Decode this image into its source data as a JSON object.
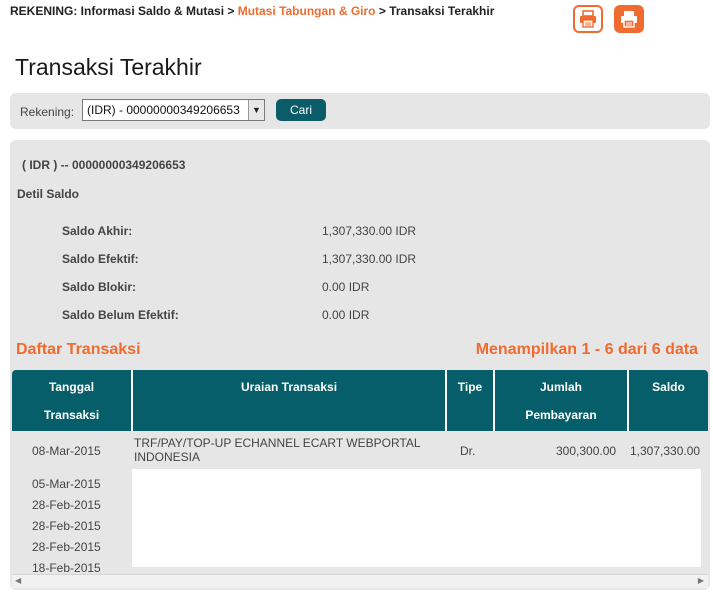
{
  "breadcrumb": {
    "section": "REKENING: Informasi Saldo & Mutasi",
    "sep1": ">",
    "link": "Mutasi Tabungan & Giro",
    "sep2": ">",
    "current": "Transaksi Terakhir"
  },
  "toolbar": {
    "print_icon": "printer-icon",
    "print_alt_icon": "printer-icon"
  },
  "page_title": "Transaksi Terakhir",
  "filter": {
    "label": "Rekening:",
    "selected": "(IDR) - 00000000349206653",
    "search_label": "Cari"
  },
  "account": {
    "header": "( IDR ) -- 00000000349206653",
    "detail_title": "Detil Saldo",
    "balances": [
      {
        "label": "Saldo Akhir:",
        "value": "1,307,330.00 IDR"
      },
      {
        "label": "Saldo Efektif:",
        "value": "1,307,330.00 IDR"
      },
      {
        "label": "Saldo Blokir:",
        "value": "0.00 IDR"
      },
      {
        "label": "Saldo Belum Efektif:",
        "value": "0.00 IDR"
      }
    ]
  },
  "transactions": {
    "title": "Daftar Transaksi",
    "count_text": "Menampilkan 1 - 6 dari 6 data",
    "headers": {
      "date_line1": "Tanggal",
      "date_line2": "Transaksi",
      "desc": "Uraian Transaksi",
      "type": "Tipe",
      "amount_line1": "Jumlah",
      "amount_line2": "Pembayaran",
      "balance": "Saldo"
    },
    "rows": [
      {
        "date": "08-Mar-2015",
        "desc_line1": "TRF/PAY/TOP-UP ECHANNEL ECART WEBPORTAL",
        "desc_line2": "INDONESIA",
        "type": "Dr.",
        "amount": "300,300.00",
        "balance": "1,307,330.00"
      },
      {
        "date": "05-Mar-2015"
      },
      {
        "date": "28-Feb-2015"
      },
      {
        "date": "28-Feb-2015"
      },
      {
        "date": "28-Feb-2015"
      },
      {
        "date": "18-Feb-2015"
      }
    ]
  },
  "colors": {
    "accent": "#f06b2f",
    "header_teal": "#065e6a",
    "panel_gray": "#e6e6e6"
  }
}
